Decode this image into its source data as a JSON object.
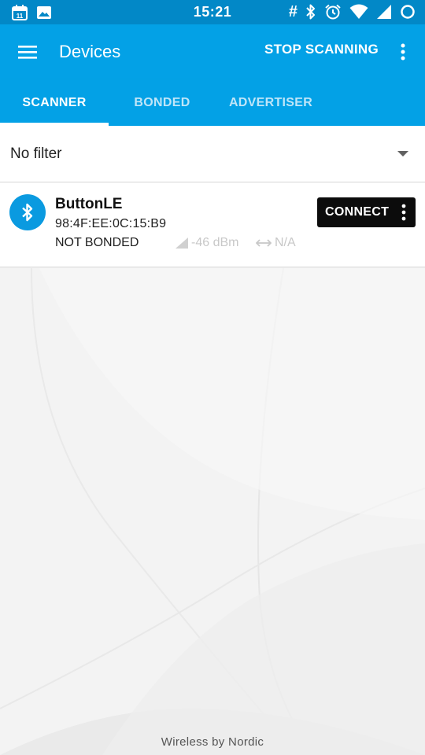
{
  "status_bar": {
    "time": "15:21",
    "left_icons": [
      "calendar-icon",
      "image-icon"
    ],
    "calendar_day": "11",
    "right_icons": [
      "hash-icon",
      "bluetooth-icon",
      "alarm-icon",
      "wifi-icon",
      "signal-icon",
      "circle-icon"
    ],
    "hash_glyph": "#"
  },
  "toolbar": {
    "title": "Devices",
    "action_label": "STOP SCANNING",
    "menu_icon": "hamburger-menu-icon",
    "overflow_icon": "more-vert-icon"
  },
  "tabs": [
    {
      "label": "SCANNER",
      "selected": true
    },
    {
      "label": "BONDED",
      "selected": false
    },
    {
      "label": "ADVERTISER",
      "selected": false
    }
  ],
  "filter": {
    "selected": "No filter",
    "icon": "dropdown-arrow-icon"
  },
  "devices": [
    {
      "name": "ButtonLE",
      "address": "98:4F:EE:0C:15:B9",
      "bond_state": "NOT BONDED",
      "rssi": "-46 dBm",
      "interval": "N/A",
      "action_label": "CONNECT",
      "icon": "bluetooth-icon"
    }
  ],
  "footer": {
    "text": "Wireless by Nordic"
  },
  "colors": {
    "status_bar": "#0288c7",
    "primary": "#03a1e6",
    "tab_inactive": "#bfe5f8",
    "connect_button": "#0c0c0c",
    "bt_badge": "#0a9ae0"
  }
}
